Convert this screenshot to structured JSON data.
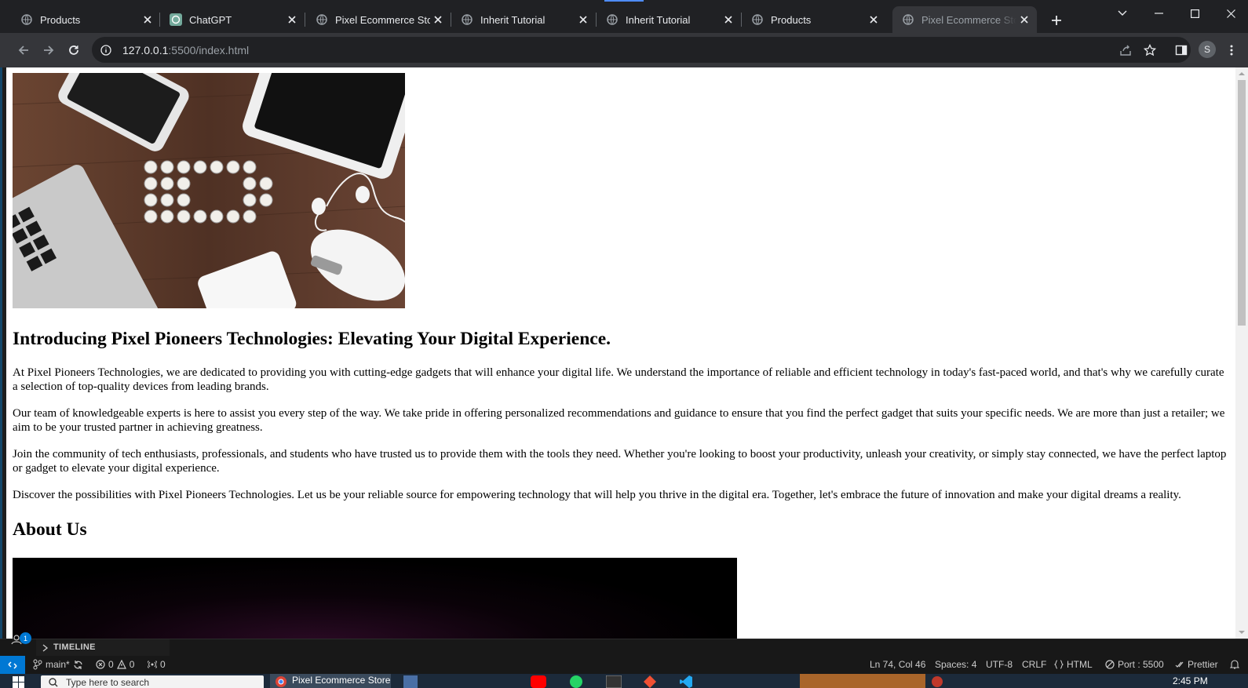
{
  "browser": {
    "tabs": [
      {
        "title": "Products",
        "favicon": "globe-icon",
        "active": false
      },
      {
        "title": "ChatGPT",
        "favicon": "chatgpt-icon",
        "active": false
      },
      {
        "title": "Pixel Ecommerce Store",
        "favicon": "globe-icon",
        "active": false
      },
      {
        "title": "Inherit Tutorial",
        "favicon": "globe-icon",
        "active": false
      },
      {
        "title": "Inherit Tutorial",
        "favicon": "globe-icon",
        "active": false
      },
      {
        "title": "Products",
        "favicon": "globe-icon",
        "active": false
      },
      {
        "title": "Pixel Ecommerce Store",
        "favicon": "globe-icon",
        "active": true
      }
    ],
    "url_host": "127.0.0.1",
    "url_path": ":5500/index.html",
    "profile_initial": "S"
  },
  "page": {
    "heading": "Introducing Pixel Pioneers Technologies: Elevating Your Digital Experience.",
    "paragraphs": [
      "At Pixel Pioneers Technologies, we are dedicated to providing you with cutting-edge gadgets that will enhance your digital life. We understand the importance of reliable and efficient technology in today's fast-paced world, and that's why we carefully curate a selection of top-quality devices from leading brands.",
      "Our team of knowledgeable experts is here to assist you every step of the way. We take pride in offering personalized recommendations and guidance to ensure that you find the perfect gadget that suits your specific needs. We are more than just a retailer; we aim to be your trusted partner in achieving greatness.",
      "Join the community of tech enthusiasts, professionals, and students who have trusted us to provide them with the tools they need. Whether you're looking to boost your productivity, unleash your creativity, or simply stay connected, we have the perfect laptop or gadget to elevate your digital experience.",
      "Discover the possibilities with Pixel Pioneers Technologies. Let us be your reliable source for empowering technology that will help you thrive in the digital era. Together, let's embrace the future of innovation and make your digital dreams a reality."
    ],
    "about_heading": "About Us"
  },
  "vscode": {
    "timeline_label": "TIMELINE",
    "accounts_badge": "1",
    "branch": "main*",
    "errors": "0",
    "warnings": "0",
    "ports": "0",
    "cursor": "Ln 74, Col 46",
    "spaces": "Spaces: 4",
    "encoding": "UTF-8",
    "eol": "CRLF",
    "language": "HTML",
    "port": "Port : 5500",
    "formatter": "Prettier"
  },
  "taskbar": {
    "search_placeholder": "Type here to search",
    "chrome_app": "Pixel Ecommerce Store",
    "clock": "2:45 PM"
  },
  "colors": {
    "chrome_dark": "#202124",
    "chrome_toolbar": "#35363a",
    "vscode_blue": "#0078d4",
    "statusbar": "#181818"
  }
}
